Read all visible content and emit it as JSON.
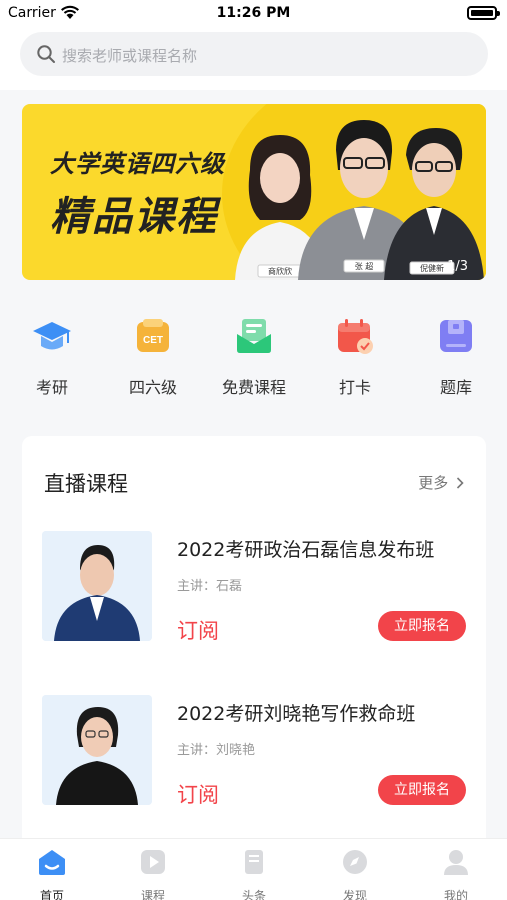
{
  "status_bar": {
    "carrier": "Carrier",
    "time": "11:26 PM"
  },
  "search": {
    "placeholder": "搜索老师或课程名称"
  },
  "banner": {
    "title_line1": "大学英语四六级",
    "title_line2": "精品课程",
    "teacher_tags": [
      "商欣欣",
      "张 超",
      "倪健新"
    ],
    "counter": "1/3"
  },
  "quick_nav": [
    {
      "label": "考研",
      "icon": "graduation-cap-icon",
      "color": "#3d8ff5"
    },
    {
      "label": "四六级",
      "icon": "cet-icon",
      "color": "#f5b33a"
    },
    {
      "label": "免费课程",
      "icon": "envelope-icon",
      "color": "#2cc77a"
    },
    {
      "label": "打卡",
      "icon": "calendar-check-icon",
      "color": "#f2574a"
    },
    {
      "label": "题库",
      "icon": "question-bank-icon",
      "color": "#7f7ef3"
    }
  ],
  "live": {
    "title": "直播课程",
    "more": "更多",
    "courses": [
      {
        "title": "2022考研政治石磊信息发布班",
        "teacher": "主讲：石磊",
        "subscribe": "订阅",
        "signup": "立即报名"
      },
      {
        "title": "2022考研刘晓艳写作救命班",
        "teacher": "主讲：刘晓艳",
        "subscribe": "订阅",
        "signup": "立即报名"
      }
    ]
  },
  "tab_bar": [
    {
      "label": "首页",
      "icon": "home-icon",
      "active": true
    },
    {
      "label": "课程",
      "icon": "play-icon",
      "active": false
    },
    {
      "label": "头条",
      "icon": "book-icon",
      "active": false
    },
    {
      "label": "发现",
      "icon": "compass-icon",
      "active": false
    },
    {
      "label": "我的",
      "icon": "user-icon",
      "active": false
    }
  ],
  "colors": {
    "accent": "#f2444a",
    "banner": "#fbd92c",
    "active_tab": "#3d8ff5"
  }
}
